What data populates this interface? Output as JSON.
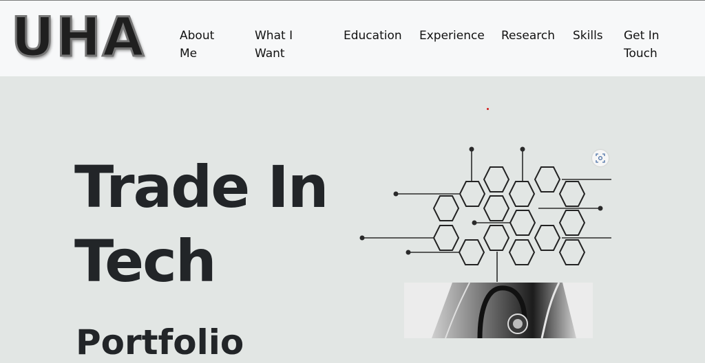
{
  "header": {
    "logo_text": "UHA",
    "nav": [
      "About Me",
      "What I Want",
      "Education",
      "Experience",
      "Research",
      "Skills",
      "Get In Touch"
    ]
  },
  "hero": {
    "title": "Trade In Tech",
    "subtitle": "Portfolio"
  },
  "icons": {
    "lens": "visual-search-icon",
    "graphic": "hexagon-circuit-graphic",
    "photo": "stethoscope-image"
  },
  "colors": {
    "header_bg": "#f7f8f9",
    "page_bg": "#e2e6e4",
    "text": "#222528"
  }
}
